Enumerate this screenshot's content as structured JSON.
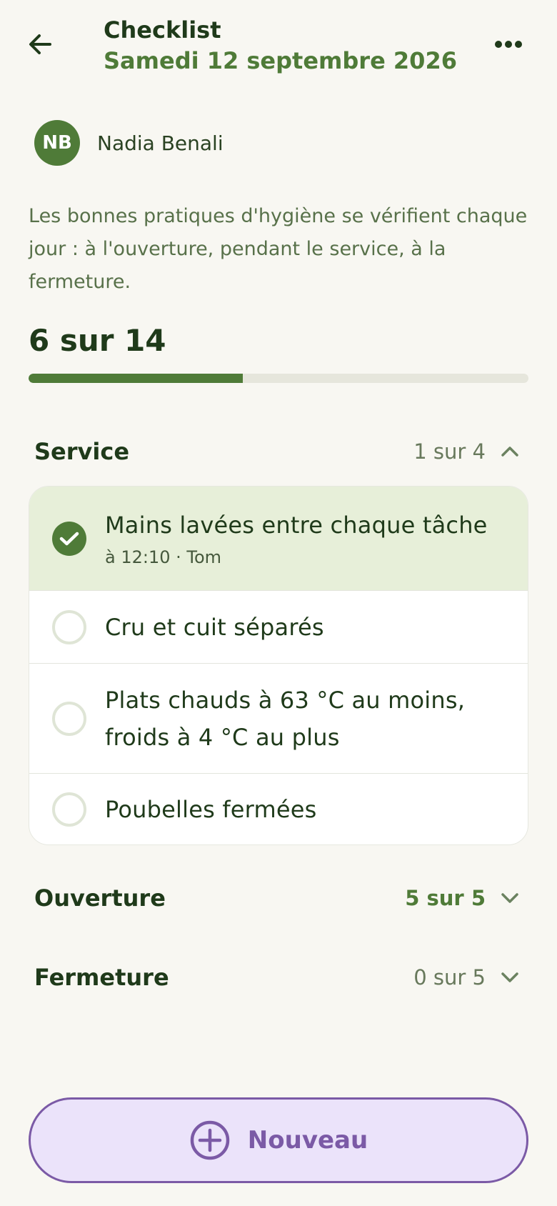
{
  "header": {
    "title": "Checklist",
    "date": "Samedi 12 septembre 2026",
    "back_icon": "arrow-left-icon",
    "more_icon": "more-horizontal-icon"
  },
  "assignee": {
    "initials": "NB",
    "name": "Nadia Benali"
  },
  "description": "Les bonnes pratiques d'hygiène se vérifient chaque jour : à l'ouverture, pendant le service, à la fermeture.",
  "progress": {
    "label": "6 sur 14",
    "done": 6,
    "total": 14
  },
  "sections": [
    {
      "title": "Service",
      "count": "1 sur 4",
      "expanded": true,
      "tasks": [
        {
          "label": "Mains lavées entre chaque tâche",
          "checked": true,
          "meta": "à 12:10 · Tom"
        },
        {
          "label": "Cru et cuit séparés",
          "checked": false
        },
        {
          "label": "Plats chauds à 63 °C au moins, froids à 4 °C au plus",
          "checked": false
        },
        {
          "label": "Poubelles fermées",
          "checked": false
        }
      ]
    },
    {
      "title": "Ouverture",
      "count": "5 sur 5",
      "expanded": false,
      "complete": true
    },
    {
      "title": "Fermeture",
      "count": "0 sur 5",
      "expanded": false
    }
  ],
  "new_button": {
    "label": "Nouveau",
    "icon": "plus-circle-icon"
  },
  "colors": {
    "background": "#f8f7f2",
    "accent_green": "#4f7b38",
    "text_dark": "#1f3a1a",
    "checked_row": "#e7efd9",
    "button_bg": "#ebe3fa",
    "button_accent": "#7b5aa6"
  }
}
